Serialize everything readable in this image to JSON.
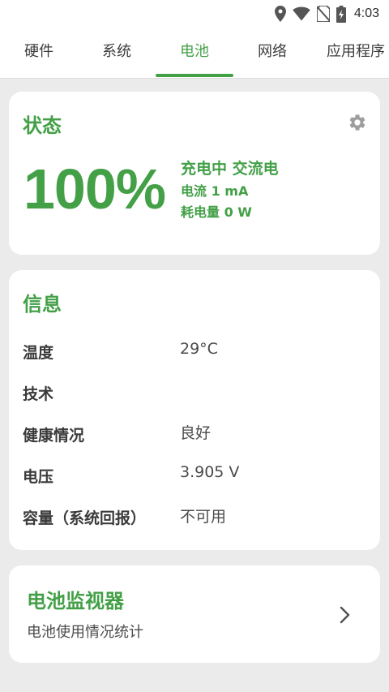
{
  "status_bar": {
    "time": "4:03",
    "icons": [
      "location-icon",
      "wifi-icon",
      "no-sim-icon",
      "battery-charging-icon"
    ]
  },
  "tabs": [
    {
      "label": "硬件",
      "active": false
    },
    {
      "label": "系统",
      "active": false
    },
    {
      "label": "电池",
      "active": true
    },
    {
      "label": "网络",
      "active": false
    },
    {
      "label": "应用程序",
      "active": false
    }
  ],
  "status_card": {
    "title": "状态",
    "settings_icon": "gear-icon",
    "battery_percent": "100%",
    "charge_state": "充电中 交流电",
    "current": "电流 1 mA",
    "power": "耗电量 0 W"
  },
  "info_card": {
    "title": "信息",
    "rows": [
      {
        "label": "温度",
        "value": "29°C"
      },
      {
        "label": "技术",
        "value": ""
      },
      {
        "label": "健康情况",
        "value": "良好"
      },
      {
        "label": "电压",
        "value": "3.905 V"
      },
      {
        "label": "容量（系统回报）",
        "value": "不可用"
      }
    ]
  },
  "monitor_card": {
    "title": "电池监视器",
    "subtitle": "电池使用情况统计",
    "chevron_icon": "chevron-right-icon"
  },
  "colors": {
    "accent": "#43a047",
    "background": "#ebebeb",
    "card": "#ffffff"
  }
}
